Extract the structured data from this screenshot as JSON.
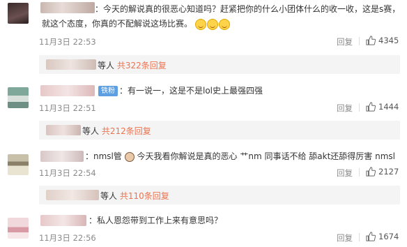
{
  "comments": [
    {
      "text_line1": "：今天的解说真的很恶心知道吗？赶紧把你的什么小团体什么的收一收，这是s赛，",
      "text_line2": "就这个态度，你真的不配解说这场比赛。",
      "date": "11月3日 22:53",
      "reply_label": "回复",
      "likes": "4345",
      "sub_prefix": "等人",
      "sub_link": "共322条回复"
    },
    {
      "badge": "铁粉",
      "text": "：有一说一，这是不是lol史上最强四强",
      "date": "11月3日 22:51",
      "reply_label": "回复",
      "likes": "1444",
      "sub_prefix": "等人",
      "sub_link": "共212条回复"
    },
    {
      "text_a": "：nmsl管",
      "text_b": "今天我看你解说是真的恶心 艹nm 同事话不给 舔akt还舔得厉害 nmsl",
      "date": "11月3日 22:54",
      "reply_label": "回复",
      "likes": "2127",
      "sub_prefix": "等人",
      "sub_link": "共110条回复"
    },
    {
      "text": "：私人恩怨带到工作上来有意思吗？",
      "date": "11月3日 22:56",
      "reply_label": "回复",
      "likes": "1674"
    }
  ],
  "colors": {
    "link": "#eb7350",
    "badge": "#5d9fe0",
    "meta": "#8a8a8a"
  },
  "icons": [
    "thumbs-up-icon",
    "smile-emoji-icon",
    "fan-badge",
    "avatar-emoji-icon"
  ]
}
